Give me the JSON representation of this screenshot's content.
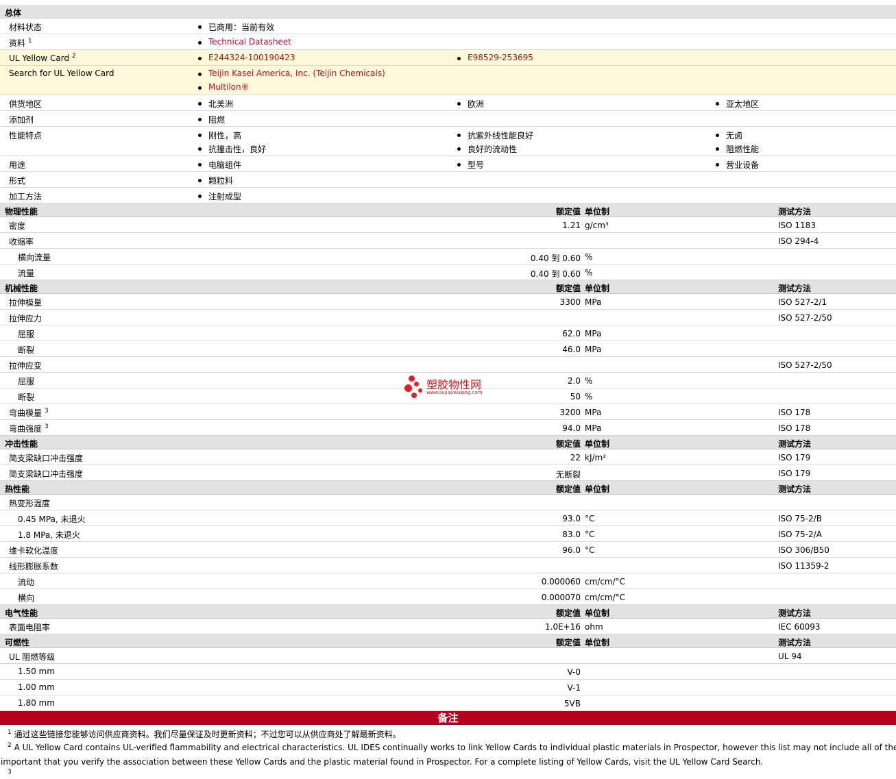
{
  "general": {
    "title": "总体",
    "material_status": {
      "label": "材料状态",
      "value": "已商用：当前有效"
    },
    "document": {
      "label": "资料",
      "sup": "1",
      "value": "Technical Datasheet"
    },
    "ul_card": {
      "label": "UL Yellow Card",
      "sup": "2",
      "values": [
        "E244324-100190423",
        "E98529-253695"
      ]
    },
    "ul_search": {
      "label": "Search for UL Yellow Card",
      "values": [
        "Teijin Kasei America, Inc. (Teijin Chemicals)",
        "Multilon®"
      ]
    },
    "supply": {
      "label": "供货地区",
      "values": [
        "北美洲",
        "欧洲",
        "亚太地区"
      ]
    },
    "additive": {
      "label": "添加剂",
      "value": "阻燃"
    },
    "features": {
      "label": "性能特点",
      "col1": [
        "刚性，高",
        "抗撞击性，良好"
      ],
      "col2": [
        "抗紫外线性能良好",
        "良好的流动性"
      ],
      "col3": [
        "无卤",
        "阻燃性能"
      ]
    },
    "uses": {
      "label": "用途",
      "values": [
        "电脑组件",
        "型号",
        "营业设备"
      ]
    },
    "form": {
      "label": "形式",
      "value": "颗粒料"
    },
    "process": {
      "label": "加工方法",
      "value": "注射成型"
    }
  },
  "headers": {
    "value": "额定值",
    "unit": "单位制",
    "method": "测试方法"
  },
  "sections": [
    {
      "title": "物理性能",
      "rows": [
        {
          "label": "密度",
          "value": "1.21",
          "unit": "g/cm³",
          "method": "ISO 1183"
        },
        {
          "label": "收缩率",
          "method": "ISO 294-4"
        },
        {
          "label": "横向流量",
          "sub": true,
          "value": "0.40 到  0.60",
          "unit": "%"
        },
        {
          "label": "流量",
          "sub": true,
          "value": "0.40 到  0.60",
          "unit": "%"
        }
      ]
    },
    {
      "title": "机械性能",
      "rows": [
        {
          "label": "拉伸模量",
          "value": "3300",
          "unit": "MPa",
          "method": "ISO 527-2/1"
        },
        {
          "label": "拉伸应力",
          "method": "ISO 527-2/50"
        },
        {
          "label": "屈服",
          "sub": true,
          "value": "62.0",
          "unit": "MPa"
        },
        {
          "label": "断裂",
          "sub": true,
          "value": "46.0",
          "unit": "MPa"
        },
        {
          "label": "拉伸应变",
          "method": "ISO 527-2/50"
        },
        {
          "label": "屈服",
          "sub": true,
          "value": "2.0",
          "unit": "%"
        },
        {
          "label": "断裂",
          "sub": true,
          "value": "50",
          "unit": "%"
        },
        {
          "label": "弯曲模量",
          "sup": "3",
          "value": "3200",
          "unit": "MPa",
          "method": "ISO 178"
        },
        {
          "label": "弯曲强度",
          "sup": "3",
          "value": "94.0",
          "unit": "MPa",
          "method": "ISO 178"
        }
      ]
    },
    {
      "title": "冲击性能",
      "rows": [
        {
          "label": "简支梁缺口冲击强度",
          "value": "22",
          "unit": "kJ/m²",
          "method": "ISO 179"
        },
        {
          "label": "简支梁缺口冲击强度",
          "value": "无断裂",
          "method": "ISO 179"
        }
      ]
    },
    {
      "title": "热性能",
      "rows": [
        {
          "label": "热变形温度"
        },
        {
          "label": "0.45 MPa, 未退火",
          "sub": true,
          "value": "93.0",
          "unit": "°C",
          "method": "ISO 75-2/B"
        },
        {
          "label": "1.8 MPa, 未退火",
          "sub": true,
          "value": "83.0",
          "unit": "°C",
          "method": "ISO 75-2/A"
        },
        {
          "label": "维卡软化温度",
          "value": "96.0",
          "unit": "°C",
          "method": "ISO 306/B50"
        },
        {
          "label": "线形膨胀系数",
          "method": "ISO 11359-2"
        },
        {
          "label": "流动",
          "sub": true,
          "value": "0.000060",
          "unit": "cm/cm/°C"
        },
        {
          "label": "横向",
          "sub": true,
          "value": "0.000070",
          "unit": "cm/cm/°C"
        }
      ]
    },
    {
      "title": "电气性能",
      "rows": [
        {
          "label": "表面电阻率",
          "value": "1.0E+16",
          "unit": "ohm",
          "method": "IEC 60093"
        }
      ]
    },
    {
      "title": "可燃性",
      "rows": [
        {
          "label": "UL 阻燃等级",
          "method": "UL 94"
        },
        {
          "label": "1.50 mm",
          "sub": true,
          "value": "V-0"
        },
        {
          "label": "1.00 mm",
          "sub": true,
          "value": "V-1"
        },
        {
          "label": "1.80 mm",
          "sub": true,
          "value": "5VB"
        }
      ]
    }
  ],
  "notes": {
    "title": "备注",
    "n1": {
      "sup": "1",
      "text": "通过这些链接您能够访问供应商资料。我们尽量保证及时更新资料；不过您可以从供应商处了解最新资料。"
    },
    "n2": {
      "sup": "2",
      "line1": "A UL Yellow Card contains UL-verified flammability and electrical characteristics. UL IDES continually works to link Yellow Cards to individual plastic materials in Prospector, however this list may not include all of the approp",
      "line2": "important that you verify the association between these Yellow Cards and the plastic material found in Prospector. For a complete listing of Yellow Cards, visit the UL Yellow Card Search."
    },
    "n3": {
      "sup": "3"
    }
  },
  "watermark": {
    "name": "塑胶物性网",
    "url": "www.sujiaowuxing.com"
  },
  "colors": {
    "accent_red": "#b3001b",
    "link_red": "#b0102a",
    "yellow_bg": "#fdf8d8",
    "header_gray": "#e2e2e2"
  }
}
